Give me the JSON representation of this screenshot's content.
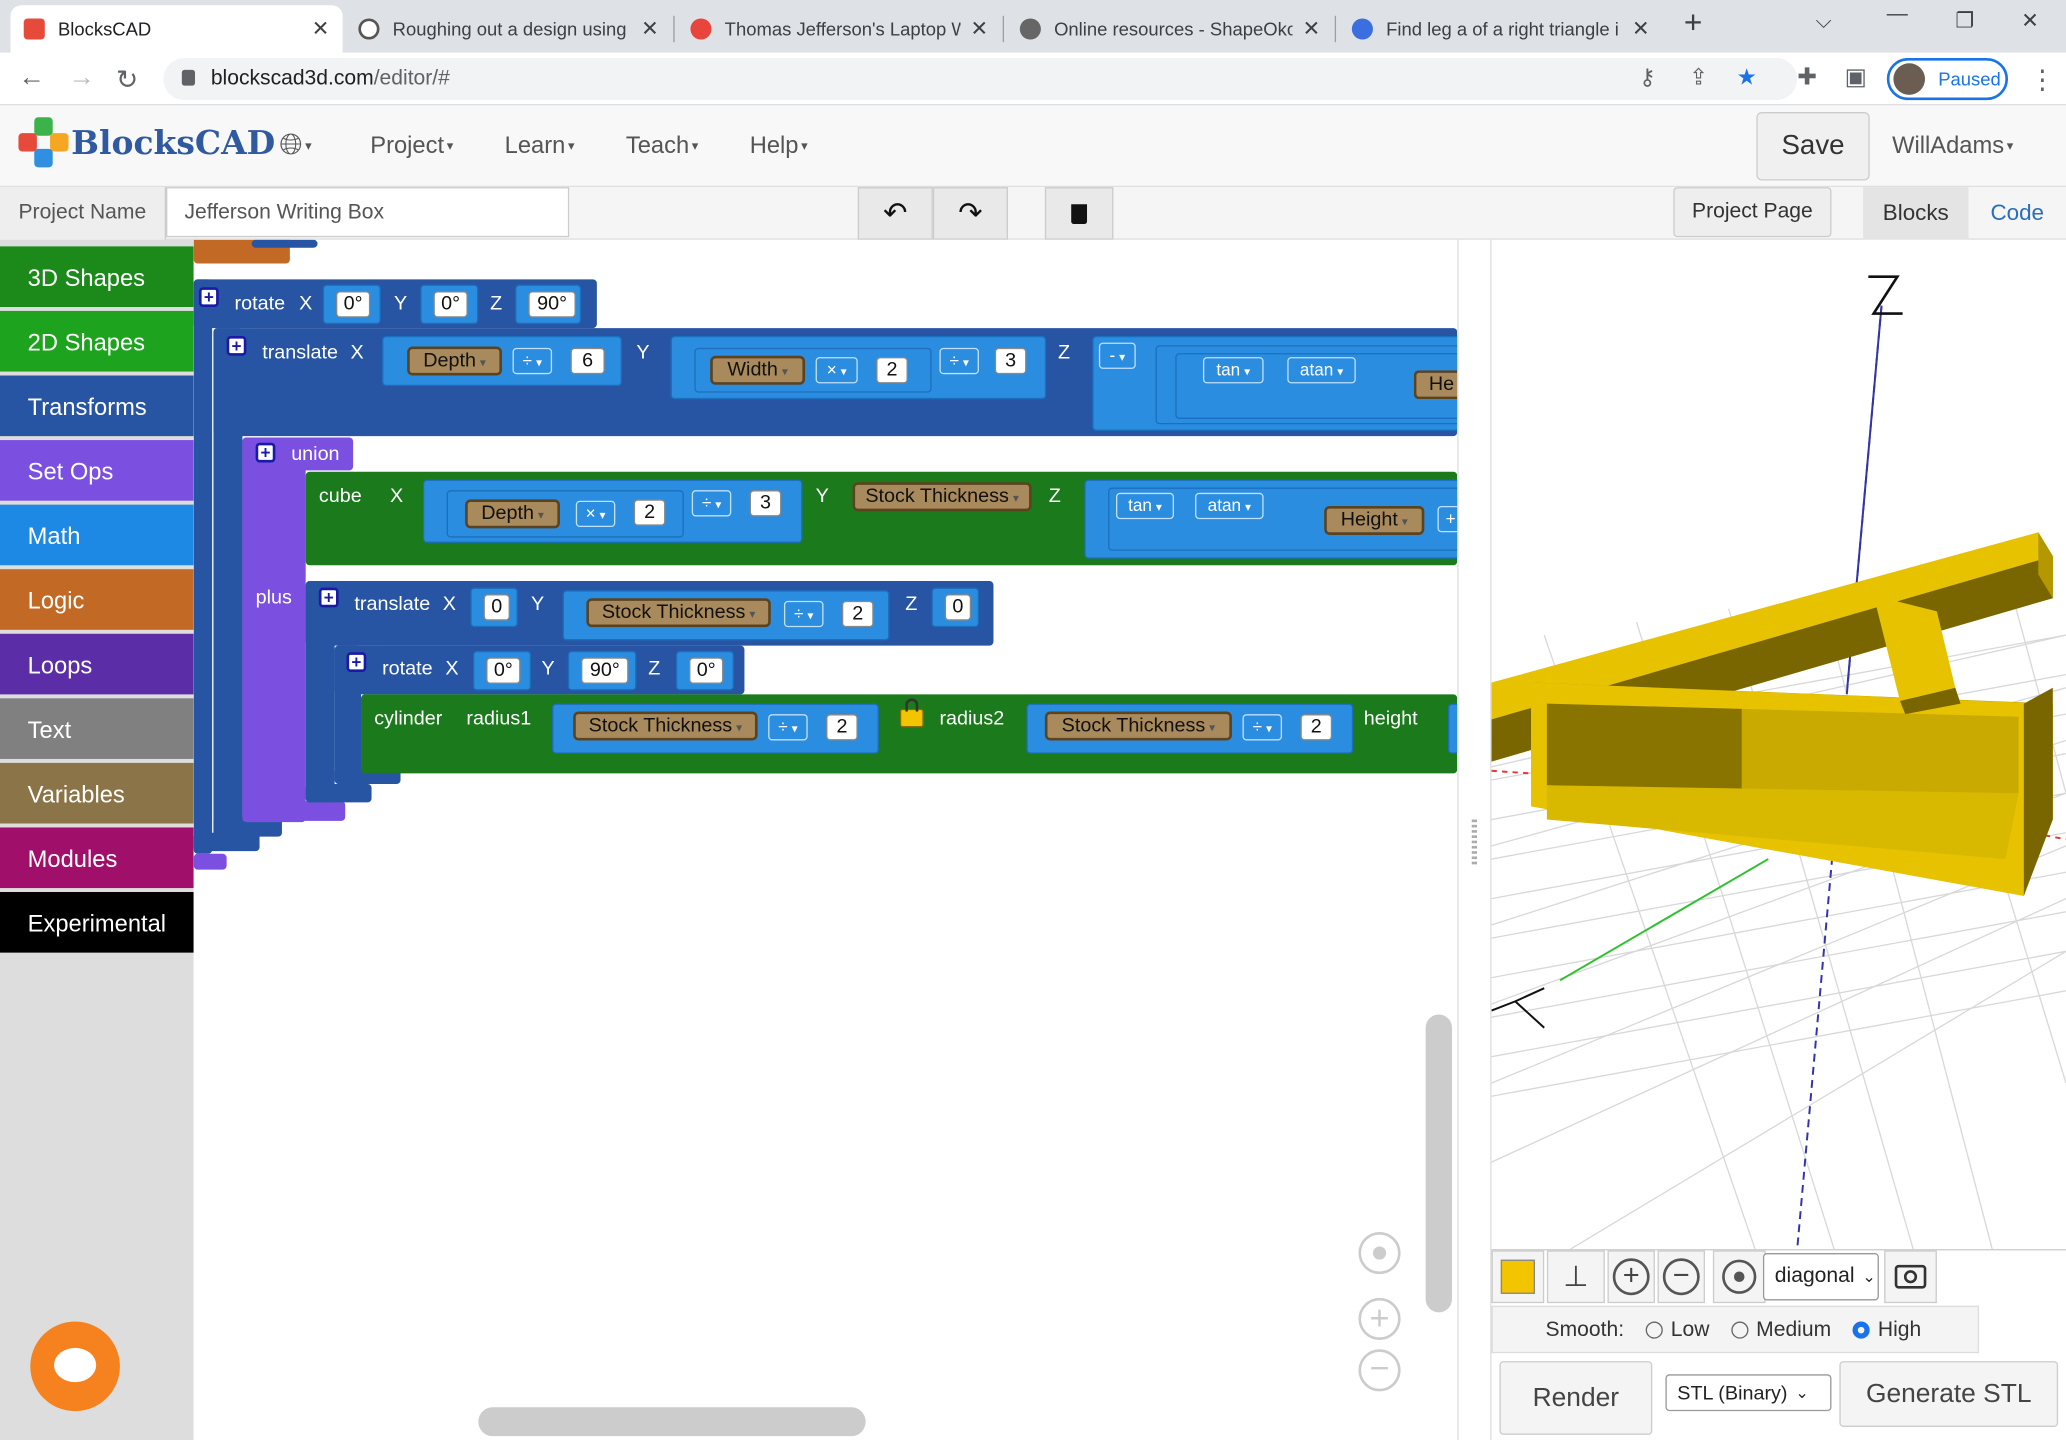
{
  "browser": {
    "tabs": [
      {
        "title": "BlocksCAD",
        "fav": "#e64a3b"
      },
      {
        "title": "Roughing out a design using",
        "fav": "#555"
      },
      {
        "title": "Thomas Jefferson's Laptop W",
        "fav": "#e8453c"
      },
      {
        "title": "Online resources - ShapeOko",
        "fav": "#666"
      },
      {
        "title": "Find leg a of a right triangle i",
        "fav": "#3b6fe0"
      }
    ],
    "url_host": "blockscad3d.com",
    "url_path": "/editor/#",
    "profile_label": "Paused"
  },
  "app": {
    "logo": "BlocksCAD",
    "menus": [
      "Project",
      "Learn",
      "Teach",
      "Help"
    ],
    "save": "Save",
    "user": "WillAdams"
  },
  "project": {
    "label": "Project Name",
    "name": "Jefferson Writing Box",
    "page_button": "Project Page",
    "tab_blocks": "Blocks",
    "tab_code": "Code"
  },
  "toolbox": [
    {
      "label": "3D Shapes",
      "color": "#1b8a1b"
    },
    {
      "label": "2D Shapes",
      "color": "#1ea31e"
    },
    {
      "label": "Transforms",
      "color": "#2855a3"
    },
    {
      "label": "Set Ops",
      "color": "#7b4fe0"
    },
    {
      "label": "Math",
      "color": "#1e88e5"
    },
    {
      "label": "Logic",
      "color": "#c26a25"
    },
    {
      "label": "Loops",
      "color": "#5b2ea8"
    },
    {
      "label": "Text",
      "color": "#808080"
    },
    {
      "label": "Variables",
      "color": "#8b7447"
    },
    {
      "label": "Modules",
      "color": "#a0106a"
    },
    {
      "label": "Experimental",
      "color": "#000000"
    }
  ],
  "blocks": {
    "rotate1": {
      "label": "rotate",
      "x": "0°",
      "y": "0°",
      "z": "90°"
    },
    "translate1": {
      "label": "translate",
      "depth": "Depth",
      "div6": "6",
      "width": "Width",
      "mul2": "2",
      "div3": "3",
      "minus": "-",
      "tan": "tan",
      "atan": "atan",
      "he": "He"
    },
    "union": {
      "label": "union",
      "plus": "plus"
    },
    "cube": {
      "label": "cube",
      "depth": "Depth",
      "two": "2",
      "three": "3",
      "stock": "Stock Thickness",
      "tan": "tan",
      "atan": "atan",
      "height": "Height",
      "plus": "+"
    },
    "translate2": {
      "label": "translate",
      "x": "0",
      "stock": "Stock Thickness",
      "two": "2",
      "z": "0"
    },
    "rotate2": {
      "label": "rotate",
      "x": "0°",
      "y": "90°",
      "z": "0°"
    },
    "cylinder": {
      "label": "cylinder",
      "radius1": "radius1",
      "stock1": "Stock Thickness",
      "two1": "2",
      "radius2": "radius2",
      "stock2": "Stock Thickness",
      "two2": "2",
      "height": "height"
    },
    "axis_x": "X",
    "axis_y": "Y",
    "axis_z": "Z",
    "op_div": "÷",
    "op_mul": "×"
  },
  "viewer": {
    "axis_z_label": "Z",
    "model_color": "#e6c200",
    "view_select": "diagonal",
    "smooth_label": "Smooth:",
    "smooth_low": "Low",
    "smooth_medium": "Medium",
    "smooth_high": "High",
    "smooth_selected": "High",
    "render": "Render",
    "format_select": "STL (Binary)",
    "generate": "Generate STL"
  }
}
